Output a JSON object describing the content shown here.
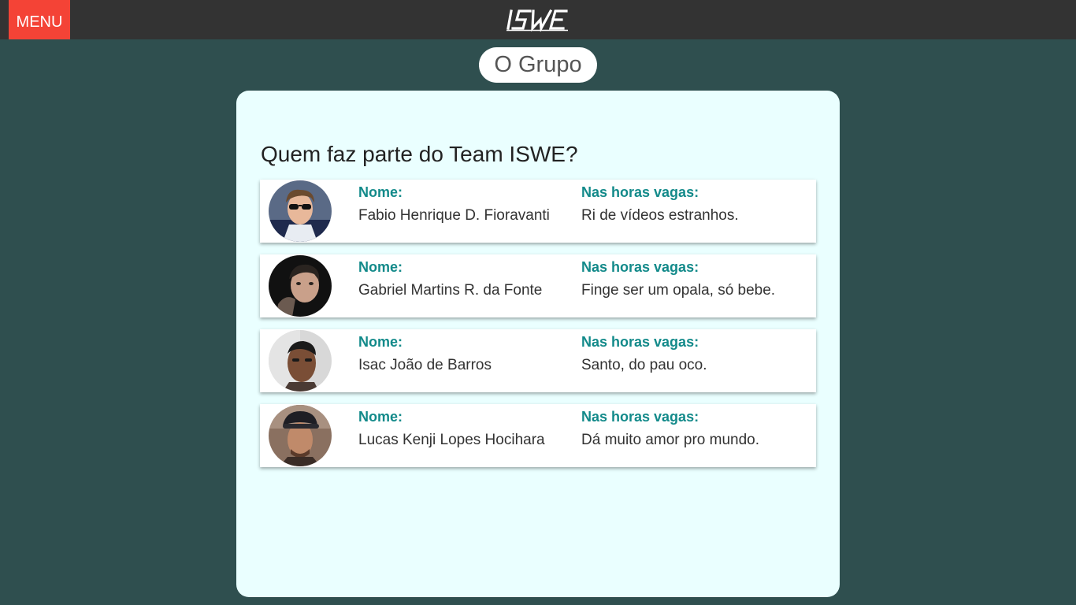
{
  "header": {
    "menu_label": "MENU",
    "logo_text": "ISWE",
    "colors": {
      "bar": "#333333",
      "menu": "#f44336"
    }
  },
  "page_pill": "O Grupo",
  "panel": {
    "heading": "Quem faz parte do Team ISWE?",
    "members": [
      {
        "name_label": "Nome:",
        "name": "Fabio Henrique D. Fioravanti",
        "hobby_label": "Nas horas vagas:",
        "hobby": "Ri de vídeos estranhos.",
        "avatar": "photo-avatar-fabio"
      },
      {
        "name_label": "Nome:",
        "name": "Gabriel Martins R. da Fonte",
        "hobby_label": "Nas horas vagas:",
        "hobby": "Finge ser um opala, só bebe.",
        "avatar": "photo-avatar-gabriel"
      },
      {
        "name_label": "Nome:",
        "name": "Isac João de Barros",
        "hobby_label": "Nas horas vagas:",
        "hobby": "Santo, do pau oco.",
        "avatar": "photo-avatar-isac"
      },
      {
        "name_label": "Nome:",
        "name": "Lucas Kenji Lopes Hocihara",
        "hobby_label": "Nas horas vagas:",
        "hobby": "Dá muito amor pro mundo.",
        "avatar": "photo-avatar-lucas"
      }
    ]
  },
  "colors": {
    "background": "#2f4f4f",
    "panel": "#eaffff",
    "label": "#138a8a"
  }
}
